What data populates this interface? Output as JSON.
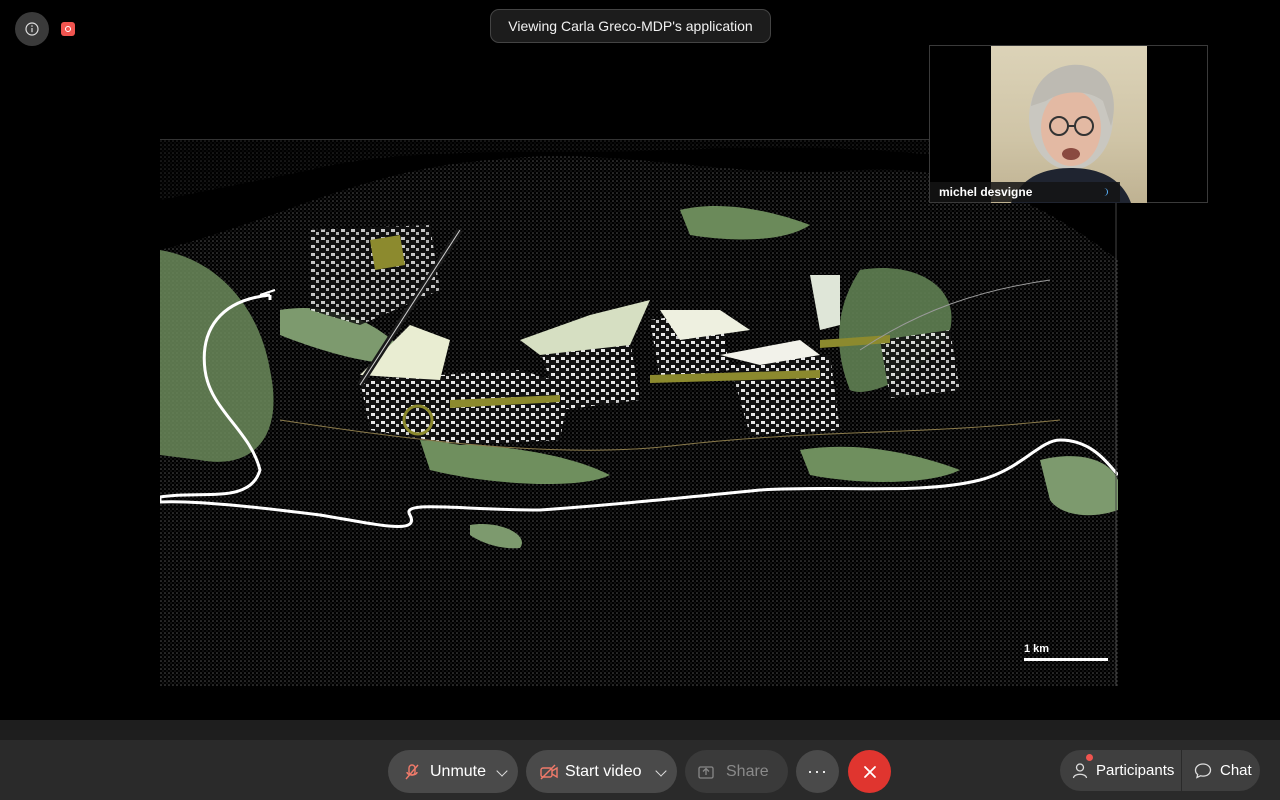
{
  "banner": {
    "text": "Viewing Carla Greco-MDP's application"
  },
  "participant": {
    "name": "michel desvigne"
  },
  "shared_content": {
    "scale_label": "1 km"
  },
  "toolbar": {
    "unmute_label": "Unmute",
    "start_video_label": "Start video",
    "share_label": "Share",
    "more_label": "···",
    "participants_label": "Participants",
    "chat_label": "Chat"
  },
  "colors": {
    "end_call": "#e0352f",
    "recording": "#f0544f",
    "map_green": "#6f8a5e",
    "map_olive": "#8c8a2e",
    "river": "#ffffff"
  },
  "icons": [
    "info-icon",
    "recording-icon",
    "mic-off-icon",
    "video-off-icon",
    "share-icon",
    "more-icon",
    "close-icon",
    "participants-icon",
    "chat-icon",
    "chevron-down-icon"
  ]
}
